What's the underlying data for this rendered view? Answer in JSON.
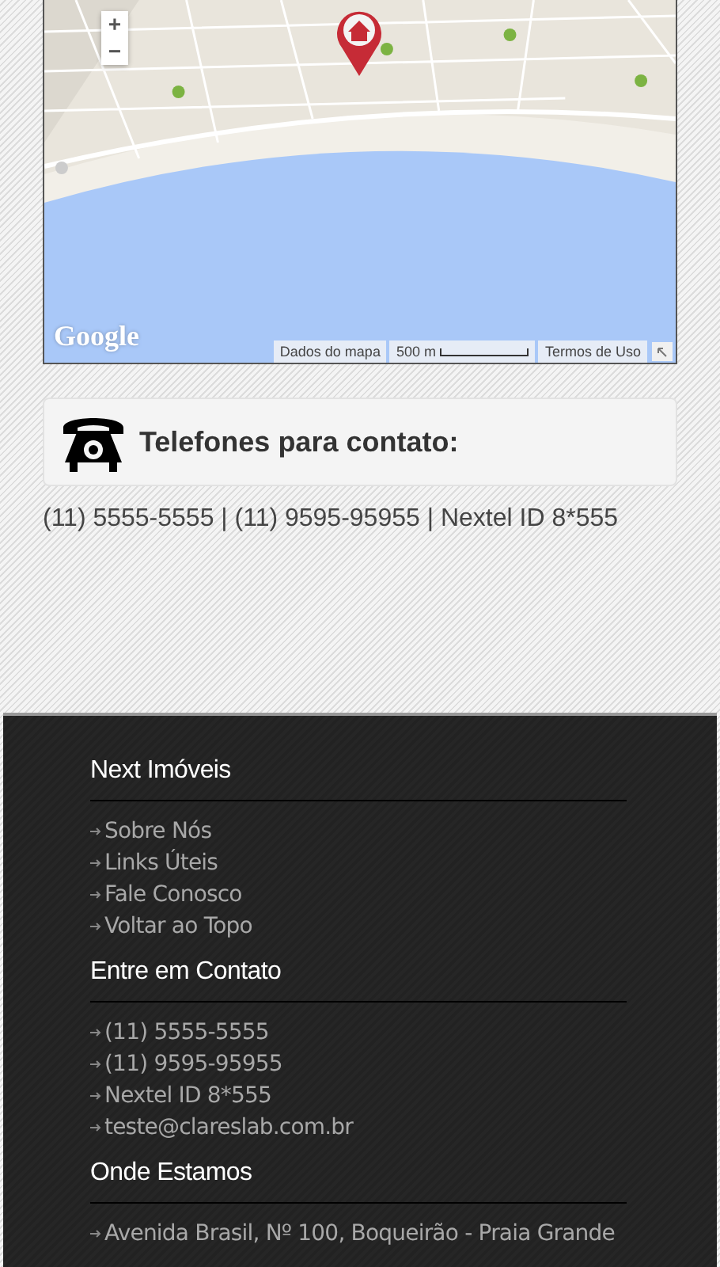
{
  "map": {
    "zoom_in": "+",
    "zoom_out": "−",
    "logo": "Google",
    "attribution": [
      "Dados do mapa",
      "500 m",
      "Termos de Uso"
    ]
  },
  "contact_box": {
    "title": "Telefones para contato:"
  },
  "phone_line": "(11) 5555-5555 | (11) 9595-95955 | Nextel ID 8*555",
  "footer": {
    "sections": [
      {
        "title": "Next Imóveis",
        "items": [
          "Sobre Nós",
          "Links Úteis",
          "Fale Conosco",
          "Voltar ao Topo"
        ]
      },
      {
        "title": "Entre em Contato",
        "items": [
          "(11) 5555-5555",
          "(11) 9595-95955",
          "Nextel ID 8*555",
          "teste@clareslab.com.br"
        ]
      },
      {
        "title": "Onde Estamos",
        "items": [
          "Avenida Brasil, Nº 100, Boqueirão - Praia Grande"
        ]
      }
    ]
  }
}
